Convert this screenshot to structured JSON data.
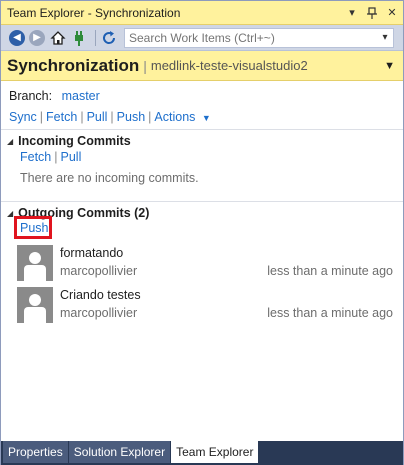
{
  "window": {
    "title": "Team Explorer - Synchronization"
  },
  "titlebar": {
    "dropdown_glyph": "▾",
    "pin_glyph": "ᚋ",
    "close_glyph": "✕"
  },
  "toolbar": {
    "search_placeholder": "Search Work Items (Ctrl+~)",
    "icons": [
      "back-icon",
      "forward-icon",
      "home-icon",
      "connect-icon",
      "refresh-icon"
    ]
  },
  "header": {
    "title": "Synchronization",
    "repo": "medlink-teste-visualstudio2"
  },
  "branch": {
    "label": "Branch:",
    "name": "master"
  },
  "actions_bar": {
    "sync": "Sync",
    "fetch": "Fetch",
    "pull": "Pull",
    "push": "Push",
    "actions": "Actions"
  },
  "incoming": {
    "title": "Incoming Commits",
    "fetch": "Fetch",
    "pull": "Pull",
    "empty_message": "There are no incoming commits."
  },
  "outgoing": {
    "title": "Outgoing Commits (2)",
    "push": "Push",
    "commits": [
      {
        "message": "formatando",
        "author": "marcopollivier",
        "time": "less than a minute ago"
      },
      {
        "message": "Criando testes",
        "author": "marcopollivier",
        "time": "less than a minute ago"
      }
    ]
  },
  "tabs": [
    {
      "label": "Properties",
      "active": false
    },
    {
      "label": "Solution Explorer",
      "active": false
    },
    {
      "label": "Team Explorer",
      "active": true
    }
  ],
  "colors": {
    "accent_yellow": "#fff29d",
    "link_blue": "#1e6fcc",
    "highlight_red": "#e0141e",
    "frame_navy": "#293955"
  }
}
